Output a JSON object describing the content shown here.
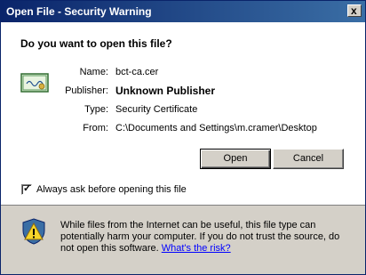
{
  "window": {
    "title": "Open File - Security Warning",
    "close_glyph": "x"
  },
  "dialog": {
    "heading": "Do you want to open this file?",
    "fields": [
      {
        "label": "Name:",
        "value": "bct-ca.cer"
      },
      {
        "label": "Publisher:",
        "value": "Unknown Publisher"
      },
      {
        "label": "Type:",
        "value": "Security Certificate"
      },
      {
        "label": "From:",
        "value": "C:\\Documents and Settings\\m.cramer\\Desktop"
      }
    ],
    "buttons": {
      "open": "Open",
      "cancel": "Cancel"
    },
    "checkbox": {
      "label": "Always ask before opening this file",
      "checked": true
    },
    "warning": {
      "text": "While files from the Internet can be useful, this file type can potentially harm your computer. If you do not trust the source, do not open this software.",
      "link": "What's the risk?"
    }
  }
}
